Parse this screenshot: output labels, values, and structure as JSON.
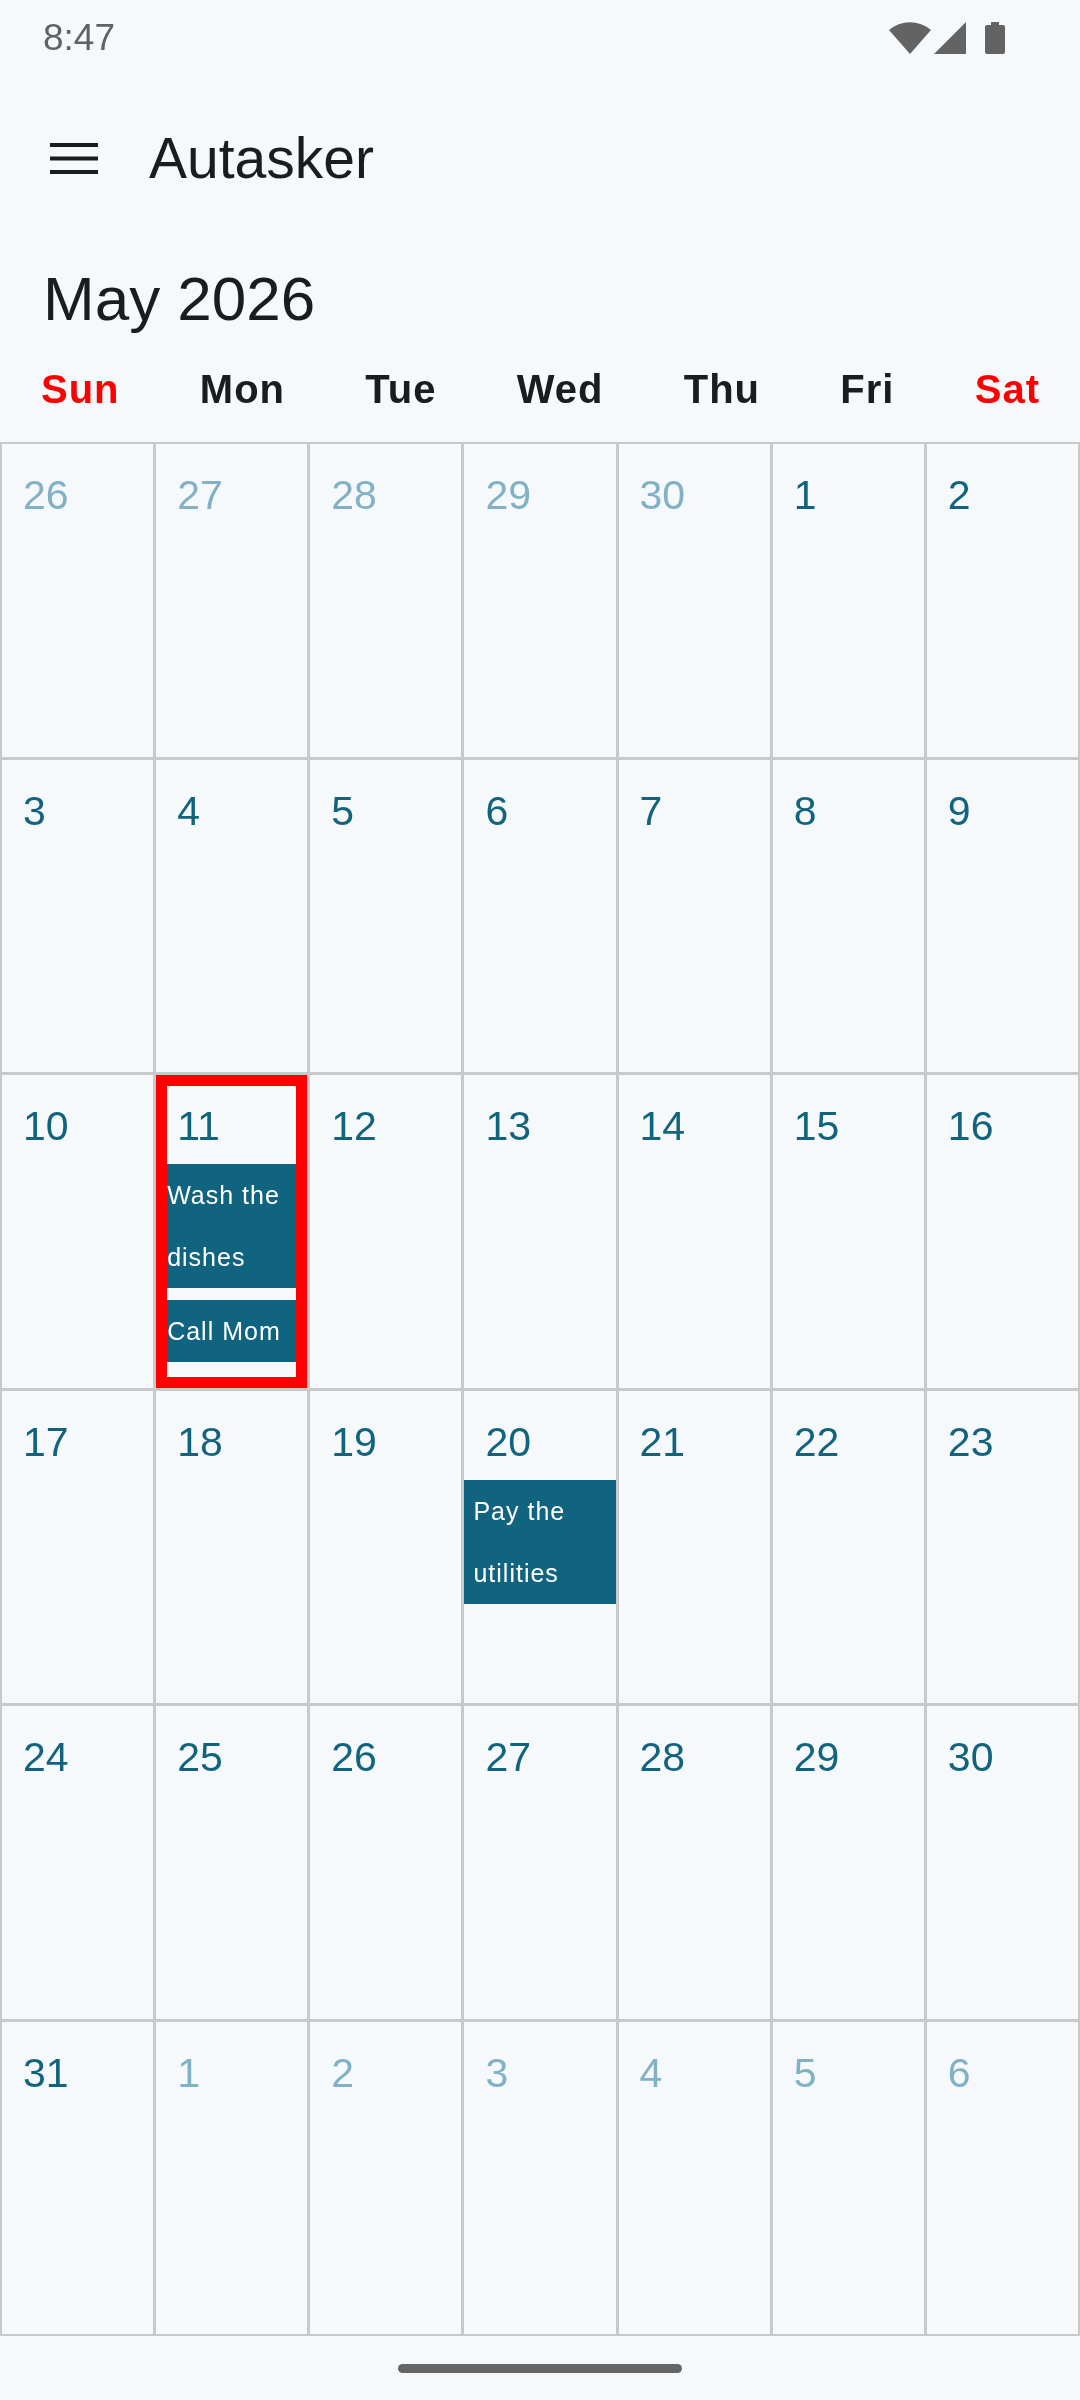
{
  "status_bar": {
    "time": "8:47"
  },
  "app_bar": {
    "title": "Autasker"
  },
  "calendar": {
    "month_title": "May 2026",
    "weekdays": [
      {
        "label": "Sun",
        "weekend": true
      },
      {
        "label": "Mon",
        "weekend": false
      },
      {
        "label": "Tue",
        "weekend": false
      },
      {
        "label": "Wed",
        "weekend": false
      },
      {
        "label": "Thu",
        "weekend": false
      },
      {
        "label": "Fri",
        "weekend": false
      },
      {
        "label": "Sat",
        "weekend": true
      }
    ],
    "weeks": [
      {
        "days": [
          {
            "number": "26",
            "in_month": false,
            "selected": false
          },
          {
            "number": "27",
            "in_month": false,
            "selected": false
          },
          {
            "number": "28",
            "in_month": false,
            "selected": false
          },
          {
            "number": "29",
            "in_month": false,
            "selected": false
          },
          {
            "number": "30",
            "in_month": false,
            "selected": false
          },
          {
            "number": "1",
            "in_month": true,
            "selected": false
          },
          {
            "number": "2",
            "in_month": true,
            "selected": false
          }
        ]
      },
      {
        "days": [
          {
            "number": "3",
            "in_month": true,
            "selected": false
          },
          {
            "number": "4",
            "in_month": true,
            "selected": false
          },
          {
            "number": "5",
            "in_month": true,
            "selected": false
          },
          {
            "number": "6",
            "in_month": true,
            "selected": false
          },
          {
            "number": "7",
            "in_month": true,
            "selected": false
          },
          {
            "number": "8",
            "in_month": true,
            "selected": false
          },
          {
            "number": "9",
            "in_month": true,
            "selected": false
          }
        ]
      },
      {
        "days": [
          {
            "number": "10",
            "in_month": true,
            "selected": false
          },
          {
            "number": "11",
            "in_month": true,
            "selected": true,
            "events": [
              {
                "title": "Wash the dishes"
              },
              {
                "title": "Call Mom"
              }
            ]
          },
          {
            "number": "12",
            "in_month": true,
            "selected": false
          },
          {
            "number": "13",
            "in_month": true,
            "selected": false
          },
          {
            "number": "14",
            "in_month": true,
            "selected": false
          },
          {
            "number": "15",
            "in_month": true,
            "selected": false
          },
          {
            "number": "16",
            "in_month": true,
            "selected": false
          }
        ]
      },
      {
        "days": [
          {
            "number": "17",
            "in_month": true,
            "selected": false
          },
          {
            "number": "18",
            "in_month": true,
            "selected": false
          },
          {
            "number": "19",
            "in_month": true,
            "selected": false
          },
          {
            "number": "20",
            "in_month": true,
            "selected": false,
            "events": [
              {
                "title": "Pay the utilities"
              }
            ]
          },
          {
            "number": "21",
            "in_month": true,
            "selected": false
          },
          {
            "number": "22",
            "in_month": true,
            "selected": false
          },
          {
            "number": "23",
            "in_month": true,
            "selected": false
          }
        ]
      },
      {
        "days": [
          {
            "number": "24",
            "in_month": true,
            "selected": false
          },
          {
            "number": "25",
            "in_month": true,
            "selected": false
          },
          {
            "number": "26",
            "in_month": true,
            "selected": false
          },
          {
            "number": "27",
            "in_month": true,
            "selected": false
          },
          {
            "number": "28",
            "in_month": true,
            "selected": false
          },
          {
            "number": "29",
            "in_month": true,
            "selected": false
          },
          {
            "number": "30",
            "in_month": true,
            "selected": false
          }
        ]
      },
      {
        "days": [
          {
            "number": "31",
            "in_month": true,
            "selected": false
          },
          {
            "number": "1",
            "in_month": false,
            "selected": false
          },
          {
            "number": "2",
            "in_month": false,
            "selected": false
          },
          {
            "number": "3",
            "in_month": false,
            "selected": false
          },
          {
            "number": "4",
            "in_month": false,
            "selected": false
          },
          {
            "number": "5",
            "in_month": false,
            "selected": false
          },
          {
            "number": "6",
            "in_month": false,
            "selected": false
          }
        ]
      }
    ]
  }
}
